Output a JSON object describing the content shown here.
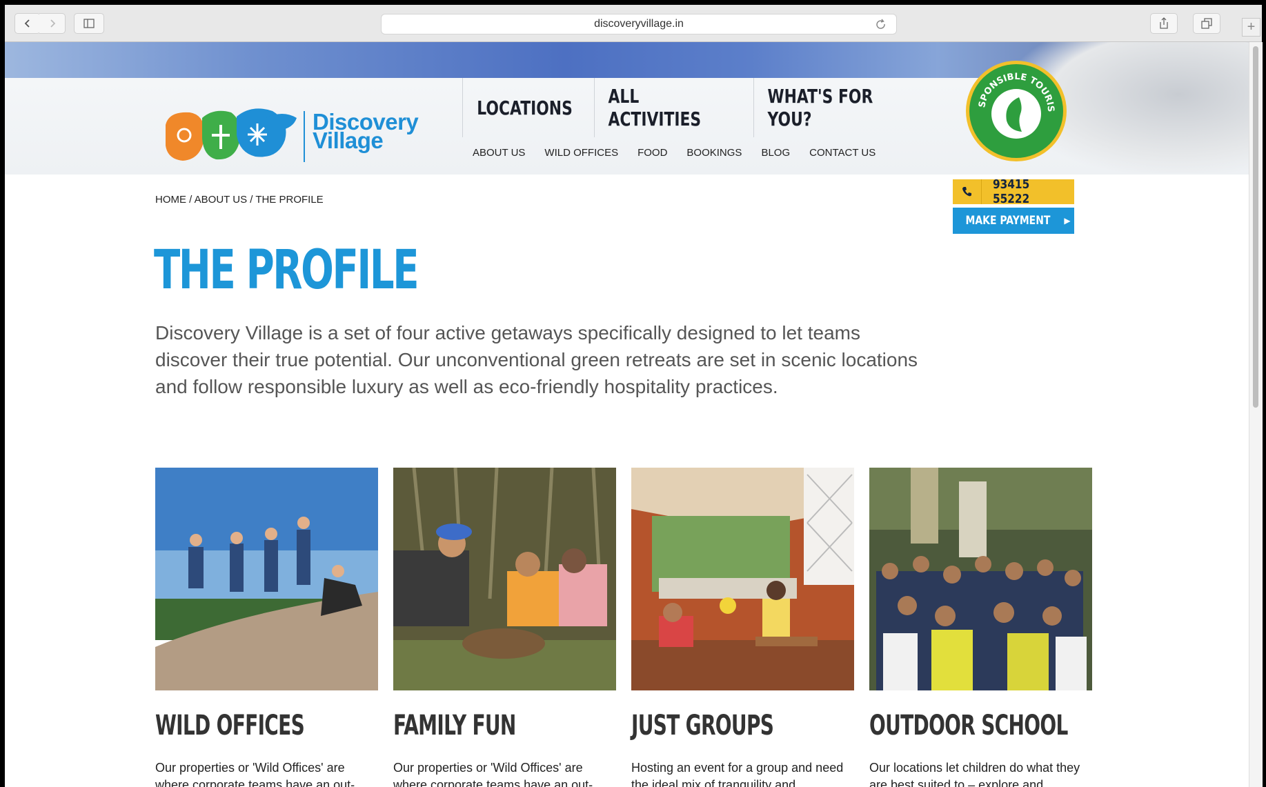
{
  "browser": {
    "url": "discoveryvillage.in"
  },
  "header": {
    "logo_text_line1": "Discovery",
    "logo_text_line2": "Village",
    "main_nav": [
      "LOCATIONS",
      "ALL ACTIVITIES",
      "WHAT'S FOR YOU?"
    ],
    "sub_nav": [
      "ABOUT US",
      "WILD OFFICES",
      "FOOD",
      "BOOKINGS",
      "BLOG",
      "CONTACT US"
    ],
    "badge_text": "RESPONSIBLE TOURISM",
    "phone": "93415 55222",
    "pay_label": "MAKE PAYMENT"
  },
  "breadcrumb": "HOME / ABOUT US / THE PROFILE",
  "page_title": "THE PROFILE",
  "intro": "Discovery Village is a set of four active getaways specifically designed to let teams discover their true potential. Our unconventional green retreats are set in scenic locations and follow responsible luxury as well as eco-friendly hospitality practices.",
  "cards": [
    {
      "title": "WILD OFFICES",
      "text": "Our properties or 'Wild Offices' are where corporate teams have an out-"
    },
    {
      "title": "FAMILY FUN",
      "text": "Our properties or 'Wild Offices' are where corporate teams have an out-"
    },
    {
      "title": "JUST GROUPS",
      "text": "Hosting an event for a group and need the ideal mix of tranquility and"
    },
    {
      "title": "OUTDOOR SCHOOL",
      "text": "Our locations let children do what they are best suited to – explore and"
    }
  ],
  "colors": {
    "accent_blue": "#1d96d8",
    "phone_yellow": "#f2c02a",
    "badge_green": "#2e9e3e"
  }
}
